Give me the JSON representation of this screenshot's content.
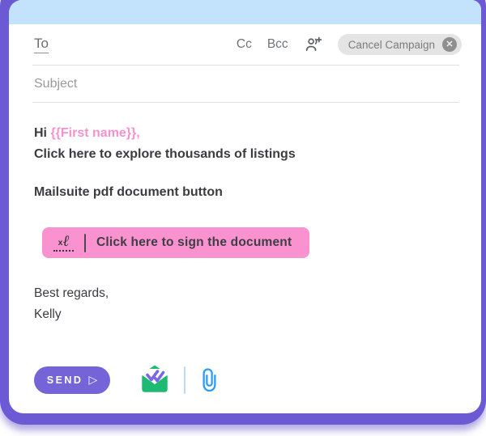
{
  "compose": {
    "to_label": "To",
    "cc_label": "Cc",
    "bcc_label": "Bcc",
    "cancel_campaign": {
      "label": "Cancel Campaign",
      "close_glyph": "✕"
    },
    "subject_placeholder": "Subject",
    "body": {
      "greeting_prefix": "Hi ",
      "merge_tag": "{{First name}},",
      "intro_line": "Click here to explore thousands of listings",
      "pdf_line": "Mailsuite pdf document button",
      "sign_button_label": "Click here to sign the document",
      "closing_line1": "Best regards,",
      "closing_line2": "Kelly"
    },
    "footer": {
      "send_label": "SEND",
      "send_arrow_glyph": "▷"
    }
  },
  "icons": {
    "person_add": "person-add-icon",
    "cancel_close": "close-icon",
    "signature": {
      "x_glyph": "x",
      "script_glyph": "ℓ"
    },
    "mailsuite_logo": "mailsuite-envelope-logo",
    "paperclip": "attachment-icon"
  },
  "colors": {
    "frame_purple": "#6b5ad3",
    "header_blue": "#c3e2fb",
    "accent_pink_text": "#f791cd",
    "sign_button_pink": "#f992ce",
    "send_purple": "#7464d8",
    "logo_green": "#1eba73",
    "logo_check_purple": "#7a67e8",
    "paperclip_blue": "#2d9cf0",
    "footer_divider_blue": "#bcdcf5"
  }
}
